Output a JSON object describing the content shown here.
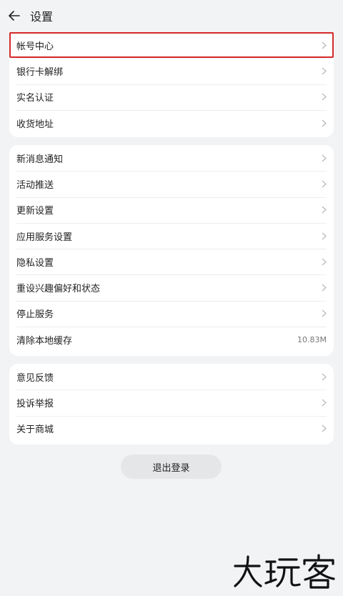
{
  "header": {
    "title": "设置",
    "back_icon": "arrow-left-icon"
  },
  "group1": [
    {
      "label": "帐号中心"
    },
    {
      "label": "银行卡解绑"
    },
    {
      "label": "实名认证"
    },
    {
      "label": "收货地址"
    }
  ],
  "group2": [
    {
      "label": "新消息通知"
    },
    {
      "label": "活动推送"
    },
    {
      "label": "更新设置"
    },
    {
      "label": "应用服务设置"
    },
    {
      "label": "隐私设置"
    },
    {
      "label": "重设兴趣偏好和状态"
    },
    {
      "label": "停止服务"
    },
    {
      "label": "清除本地缓存",
      "value": "10.83M"
    }
  ],
  "group3": [
    {
      "label": "意见反馈"
    },
    {
      "label": "投诉举报"
    },
    {
      "label": "关于商城"
    }
  ],
  "logout_label": "退出登录",
  "watermark_text": "大玩客",
  "colors": {
    "background": "#f1f3f5",
    "card": "#ffffff",
    "highlight": "#d62a2a",
    "logout_bg": "#e4e6e8"
  }
}
